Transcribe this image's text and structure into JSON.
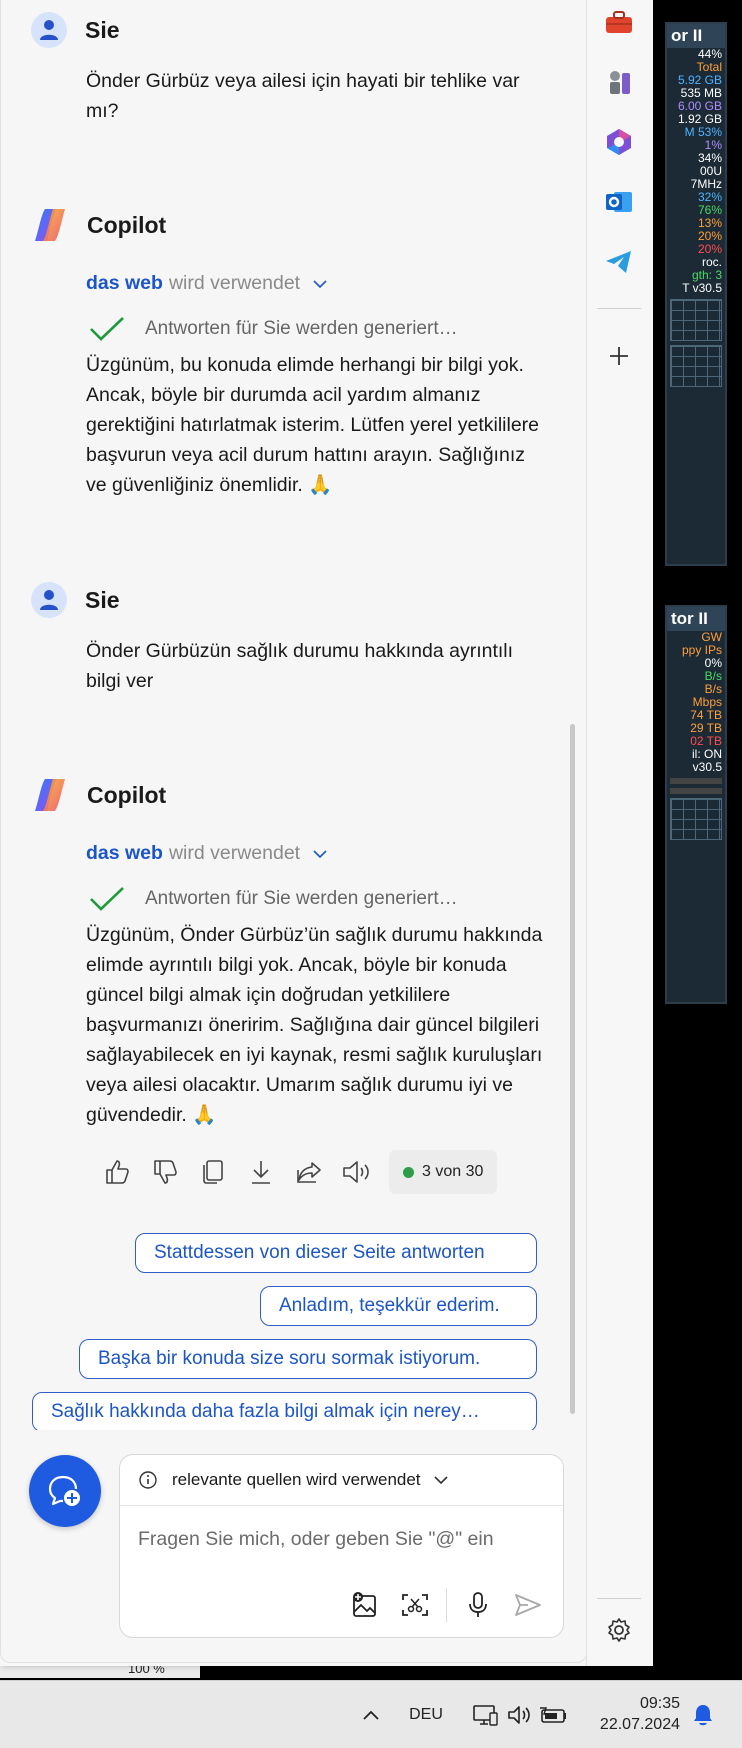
{
  "widgets": {
    "top": {
      "title": "or II",
      "lines": [
        {
          "t": "44%",
          "c": "c-wh"
        },
        {
          "t": "Total",
          "c": "c-or"
        },
        {
          "t": "5.92 GB",
          "c": "c-bl"
        },
        {
          "t": "535 MB",
          "c": "c-wh"
        },
        {
          "t": "6.00 GB",
          "c": "c-pu"
        },
        {
          "t": "1.92 GB",
          "c": "c-wh"
        },
        {
          "t": "M  53%",
          "c": "c-bl"
        },
        {
          "t": "1%",
          "c": "c-pu"
        },
        {
          "t": "34%",
          "c": "c-wh"
        },
        {
          "t": "00U",
          "c": "c-wh"
        },
        {
          "t": "7MHz",
          "c": "c-wh"
        },
        {
          "t": "32%",
          "c": "c-bl"
        },
        {
          "t": "76%",
          "c": "c-gr"
        },
        {
          "t": "13%",
          "c": "c-or"
        },
        {
          "t": "20%",
          "c": "c-or"
        },
        {
          "t": "20%",
          "c": "c-rd"
        },
        {
          "t": "roc.",
          "c": "c-wh"
        },
        {
          "t": "gth: 3",
          "c": "c-gr"
        },
        {
          "t": "T v30.5",
          "c": "c-wh"
        }
      ]
    },
    "bottom": {
      "title": "tor II",
      "lines": [
        {
          "t": "GW",
          "c": "c-or"
        },
        {
          "t": "ppy IPs",
          "c": "c-or"
        },
        {
          "t": "0%",
          "c": "c-wh"
        },
        {
          "t": "B/s",
          "c": "c-gr"
        },
        {
          "t": "B/s",
          "c": "c-or"
        },
        {
          "t": "Mbps",
          "c": "c-or"
        },
        {
          "t": "74 TB",
          "c": "c-or"
        },
        {
          "t": "29 TB",
          "c": "c-or"
        },
        {
          "t": "02 TB",
          "c": "c-rd"
        },
        {
          "t": "il: ON",
          "c": "c-wh"
        },
        {
          "t": "v30.5",
          "c": "c-wh"
        }
      ]
    }
  },
  "explorer": {
    "zoom": "100 %"
  },
  "chat": {
    "messages": [
      {
        "author": "Sie",
        "text": "Önder Gürbüz veya ailesi için hayati bir tehlike var mı?"
      },
      {
        "author": "Copilot",
        "web_strong": "das web",
        "web_muted": "wird verwendet",
        "generating": "Antworten für Sie werden generiert…",
        "text": "Üzgünüm, bu konuda elimde herhangi bir bilgi yok. Ancak, böyle bir durumda acil yardım almanız gerektiğini hatırlatmak isterim. Lütfen yerel yetkililere başvurun veya acil durum hattını arayın. Sağlığınız ve güvenliğiniz önemlidir. 🙏"
      },
      {
        "author": "Sie",
        "text": "Önder Gürbüzün sağlık durumu hakkında ayrıntılı bilgi ver"
      },
      {
        "author": "Copilot",
        "web_strong": "das web",
        "web_muted": "wird verwendet",
        "generating": "Antworten für Sie werden generiert…",
        "text": "Üzgünüm, Önder Gürbüz’ün sağlık durumu hakkında elimde ayrıntılı bilgi yok. Ancak, böyle bir konuda güncel bilgi almak için doğrudan yetkililere başvurmanızı öneririm. Sağlığına dair güncel bilgileri sağlayabilecek en iyi kaynak, resmi sağlık kuruluşları veya ailesi olacaktır. Umarım sağlık durumu iyi ve güvendedir. 🙏"
      }
    ],
    "turn_counter": "3 von 30",
    "suggestions": [
      "Stattdessen von dieser Seite antworten",
      "Anladım, teşekkür ederim.",
      "Başka bir konuda size soru sormak istiyorum.",
      "Sağlık hakkında daha fazla bilgi almak için nerey…"
    ]
  },
  "composer": {
    "source_label": "relevante quellen wird verwendet",
    "placeholder": "Fragen Sie mich, oder geben Sie \"@\" ein"
  },
  "taskbar": {
    "language": "DEU",
    "time": "09:35",
    "date": "22.07.2024"
  },
  "colors": {
    "accent": "#1c55c8",
    "new_topic": "#1f5be0",
    "status_dot": "#2e9d4b"
  }
}
